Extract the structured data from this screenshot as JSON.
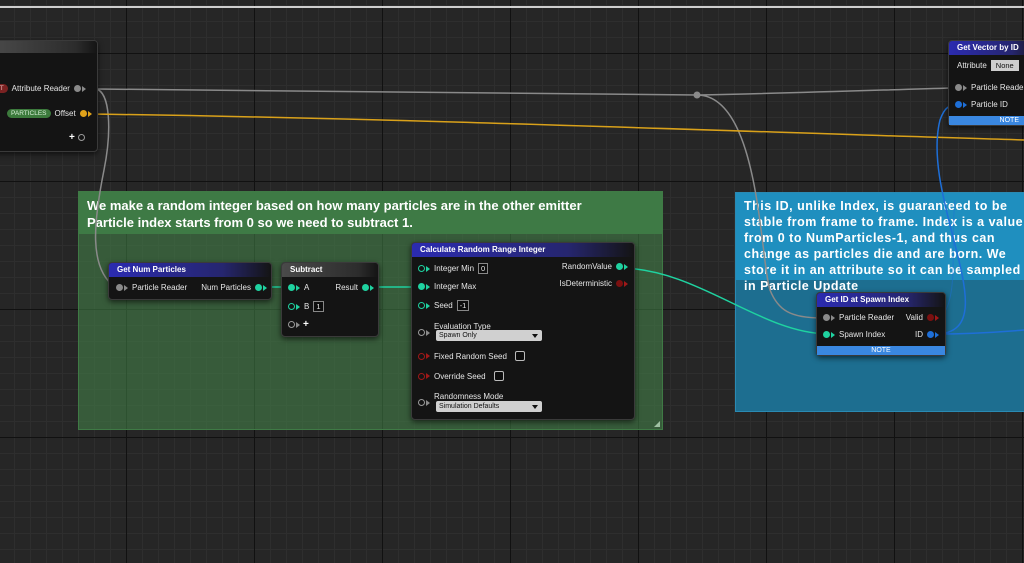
{
  "comments": {
    "green": {
      "line1": "We make a random integer based on how many particles are in the other emitter",
      "line2": "Particle index starts from 0 so we need to subtract 1."
    },
    "blue": {
      "text": "This ID, unlike Index, is guaranteed to be stable from frame to frame. Index is a value from 0 to NumParticles-1, and thus can change as particles die and are born. We store it in an attribute so it can be sampled in Particle Update"
    }
  },
  "left_node": {
    "pill_red": "UT",
    "attr_reader": "Attribute Reader",
    "pill_green": "PARTICLES",
    "offset": "Offset",
    "add_pin": "+"
  },
  "get_num_particles": {
    "title": "Get Num Particles",
    "in": "Particle Reader",
    "out": "Num Particles"
  },
  "subtract": {
    "title": "Subtract",
    "a": "A",
    "b": "B",
    "b_val": "1",
    "result": "Result",
    "add_pin": "+"
  },
  "random_range": {
    "title": "Calculate Random Range Integer",
    "integer_min": "Integer Min",
    "integer_min_val": "0",
    "integer_max": "Integer Max",
    "seed": "Seed",
    "seed_val": "-1",
    "evaluation_type": "Evaluation Type",
    "evaluation_value": "Spawn Only",
    "fixed_seed": "Fixed Random Seed",
    "override_seed": "Override Seed",
    "randomness_mode": "Randomness Mode",
    "randomness_value": "Simulation Defaults",
    "out_random": "RandomValue",
    "out_det": "IsDeterministic"
  },
  "spawn_index": {
    "title": "Get ID at Spawn Index",
    "reader": "Particle Reader",
    "spawn_index": "Spawn Index",
    "valid": "Valid",
    "id": "ID",
    "note": "NOTE"
  },
  "vector_by_id": {
    "title": "Get Vector by ID",
    "attribute": "Attribute",
    "attribute_val": "None",
    "reader": "Particle Reader",
    "pid": "Particle ID",
    "note": "NOTE"
  },
  "colors": {
    "teal": "#1fd2a0",
    "blue": "#1e6fd8",
    "yellow": "#e0a21a",
    "gray": "#8a8a8a",
    "comment_green": "#3e7a45",
    "comment_blue": "#1f8fbf"
  }
}
